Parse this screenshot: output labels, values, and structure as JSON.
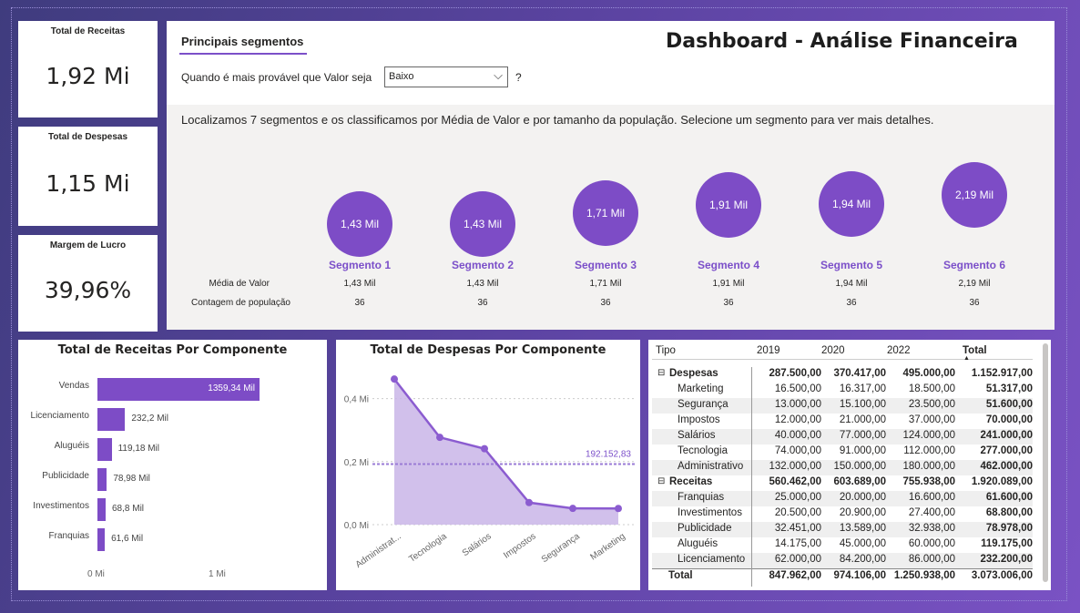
{
  "kpis": [
    {
      "title": "Total de Receitas",
      "value": "1,92 Mi"
    },
    {
      "title": "Total de Despesas",
      "value": "1,15 Mi"
    },
    {
      "title": "Margem de Lucro",
      "value": "39,96%"
    }
  ],
  "segments_panel": {
    "tab": "Principais segmentos",
    "question": "Quando é mais provável que Valor seja",
    "dropdown_value": "Baixo",
    "question_mark": "?",
    "description": "Localizamos 7 segmentos e os classificamos por Média de Valor e por tamanho da população. Selecione um segmento para ver mais detalhes.",
    "row_label_avg": "Média de Valor",
    "row_label_count": "Contagem de população",
    "segments": [
      {
        "name": "Segmento 1",
        "bubble": "1,43 Mil",
        "avg": "1,43 Mil",
        "count": "36"
      },
      {
        "name": "Segmento 2",
        "bubble": "1,43 Mil",
        "avg": "1,43 Mil",
        "count": "36"
      },
      {
        "name": "Segmento 3",
        "bubble": "1,71 Mil",
        "avg": "1,71 Mil",
        "count": "36"
      },
      {
        "name": "Segmento 4",
        "bubble": "1,91 Mil",
        "avg": "1,91 Mil",
        "count": "36"
      },
      {
        "name": "Segmento 5",
        "bubble": "1,94 Mil",
        "avg": "1,94 Mil",
        "count": "36"
      },
      {
        "name": "Segmento 6",
        "bubble": "2,19 Mil",
        "avg": "2,19 Mil",
        "count": "36"
      }
    ]
  },
  "dashboard_title": "Dashboard - Análise Financeira",
  "colors": {
    "accent": "#7d4cc6",
    "area_fill": "#c9b5e8",
    "line": "#8b5cd0"
  },
  "chart_data": [
    {
      "type": "bar",
      "title": "Total de Receitas Por Componente",
      "categories": [
        "Vendas",
        "Licenciamento",
        "Aluguéis",
        "Publicidade",
        "Investimentos",
        "Franquias"
      ],
      "values": [
        1359.34,
        232.2,
        119.18,
        78.98,
        68.8,
        61.6
      ],
      "value_labels": [
        "1359,34 Mil",
        "232,2 Mil",
        "119,18 Mil",
        "78,98 Mil",
        "68,8 Mil",
        "61,6 Mil"
      ],
      "x_ticks": [
        "0 Mi",
        "1 Mi"
      ],
      "xlim": [
        0,
        1750
      ]
    },
    {
      "type": "area",
      "title": "Total de Despesas Por Componente",
      "categories": [
        "Administrat...",
        "Tecnologia",
        "Salários",
        "Impostos",
        "Segurança",
        "Marketing"
      ],
      "values": [
        462000,
        277000,
        241000,
        70000,
        51600,
        51317
      ],
      "average": 192152.83,
      "average_label": "192.152,83",
      "y_ticks": [
        "0,0 Mi",
        "0,2 Mi",
        "0,4 Mi"
      ],
      "ylim": [
        0,
        500000
      ]
    }
  ],
  "table": {
    "headers": [
      "Tipo",
      "2019",
      "2020",
      "2022",
      "Total"
    ],
    "rows": [
      {
        "kind": "group",
        "label": "Despesas",
        "v": [
          "287.500,00",
          "370.417,00",
          "495.000,00",
          "1.152.917,00"
        ]
      },
      {
        "kind": "item",
        "label": "Marketing",
        "v": [
          "16.500,00",
          "16.317,00",
          "18.500,00",
          "51.317,00"
        ]
      },
      {
        "kind": "item",
        "label": "Segurança",
        "v": [
          "13.000,00",
          "15.100,00",
          "23.500,00",
          "51.600,00"
        ]
      },
      {
        "kind": "item",
        "label": "Impostos",
        "v": [
          "12.000,00",
          "21.000,00",
          "37.000,00",
          "70.000,00"
        ]
      },
      {
        "kind": "item",
        "label": "Salários",
        "v": [
          "40.000,00",
          "77.000,00",
          "124.000,00",
          "241.000,00"
        ]
      },
      {
        "kind": "item",
        "label": "Tecnologia",
        "v": [
          "74.000,00",
          "91.000,00",
          "112.000,00",
          "277.000,00"
        ]
      },
      {
        "kind": "item",
        "label": "Administrativo",
        "v": [
          "132.000,00",
          "150.000,00",
          "180.000,00",
          "462.000,00"
        ]
      },
      {
        "kind": "group",
        "label": "Receitas",
        "v": [
          "560.462,00",
          "603.689,00",
          "755.938,00",
          "1.920.089,00"
        ]
      },
      {
        "kind": "item",
        "label": "Franquias",
        "v": [
          "25.000,00",
          "20.000,00",
          "16.600,00",
          "61.600,00"
        ]
      },
      {
        "kind": "item",
        "label": "Investimentos",
        "v": [
          "20.500,00",
          "20.900,00",
          "27.400,00",
          "68.800,00"
        ]
      },
      {
        "kind": "item",
        "label": "Publicidade",
        "v": [
          "32.451,00",
          "13.589,00",
          "32.938,00",
          "78.978,00"
        ]
      },
      {
        "kind": "item",
        "label": "Aluguéis",
        "v": [
          "14.175,00",
          "45.000,00",
          "60.000,00",
          "119.175,00"
        ]
      },
      {
        "kind": "item",
        "label": "Licenciamento",
        "v": [
          "62.000,00",
          "84.200,00",
          "86.000,00",
          "232.200,00"
        ]
      },
      {
        "kind": "total",
        "label": "Total",
        "v": [
          "847.962,00",
          "974.106,00",
          "1.250.938,00",
          "3.073.006,00"
        ]
      }
    ]
  }
}
